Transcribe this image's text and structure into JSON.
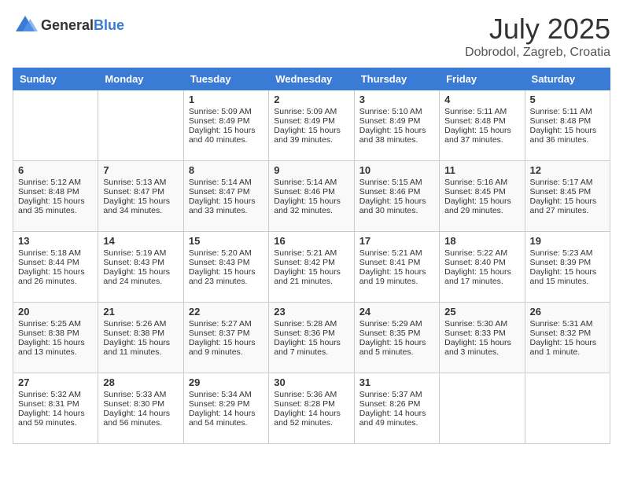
{
  "header": {
    "logo_general": "General",
    "logo_blue": "Blue",
    "month": "July 2025",
    "location": "Dobrodol, Zagreb, Croatia"
  },
  "weekdays": [
    "Sunday",
    "Monday",
    "Tuesday",
    "Wednesday",
    "Thursday",
    "Friday",
    "Saturday"
  ],
  "weeks": [
    [
      {
        "day": "",
        "sunrise": "",
        "sunset": "",
        "daylight": ""
      },
      {
        "day": "",
        "sunrise": "",
        "sunset": "",
        "daylight": ""
      },
      {
        "day": "1",
        "sunrise": "Sunrise: 5:09 AM",
        "sunset": "Sunset: 8:49 PM",
        "daylight": "Daylight: 15 hours and 40 minutes."
      },
      {
        "day": "2",
        "sunrise": "Sunrise: 5:09 AM",
        "sunset": "Sunset: 8:49 PM",
        "daylight": "Daylight: 15 hours and 39 minutes."
      },
      {
        "day": "3",
        "sunrise": "Sunrise: 5:10 AM",
        "sunset": "Sunset: 8:49 PM",
        "daylight": "Daylight: 15 hours and 38 minutes."
      },
      {
        "day": "4",
        "sunrise": "Sunrise: 5:11 AM",
        "sunset": "Sunset: 8:48 PM",
        "daylight": "Daylight: 15 hours and 37 minutes."
      },
      {
        "day": "5",
        "sunrise": "Sunrise: 5:11 AM",
        "sunset": "Sunset: 8:48 PM",
        "daylight": "Daylight: 15 hours and 36 minutes."
      }
    ],
    [
      {
        "day": "6",
        "sunrise": "Sunrise: 5:12 AM",
        "sunset": "Sunset: 8:48 PM",
        "daylight": "Daylight: 15 hours and 35 minutes."
      },
      {
        "day": "7",
        "sunrise": "Sunrise: 5:13 AM",
        "sunset": "Sunset: 8:47 PM",
        "daylight": "Daylight: 15 hours and 34 minutes."
      },
      {
        "day": "8",
        "sunrise": "Sunrise: 5:14 AM",
        "sunset": "Sunset: 8:47 PM",
        "daylight": "Daylight: 15 hours and 33 minutes."
      },
      {
        "day": "9",
        "sunrise": "Sunrise: 5:14 AM",
        "sunset": "Sunset: 8:46 PM",
        "daylight": "Daylight: 15 hours and 32 minutes."
      },
      {
        "day": "10",
        "sunrise": "Sunrise: 5:15 AM",
        "sunset": "Sunset: 8:46 PM",
        "daylight": "Daylight: 15 hours and 30 minutes."
      },
      {
        "day": "11",
        "sunrise": "Sunrise: 5:16 AM",
        "sunset": "Sunset: 8:45 PM",
        "daylight": "Daylight: 15 hours and 29 minutes."
      },
      {
        "day": "12",
        "sunrise": "Sunrise: 5:17 AM",
        "sunset": "Sunset: 8:45 PM",
        "daylight": "Daylight: 15 hours and 27 minutes."
      }
    ],
    [
      {
        "day": "13",
        "sunrise": "Sunrise: 5:18 AM",
        "sunset": "Sunset: 8:44 PM",
        "daylight": "Daylight: 15 hours and 26 minutes."
      },
      {
        "day": "14",
        "sunrise": "Sunrise: 5:19 AM",
        "sunset": "Sunset: 8:43 PM",
        "daylight": "Daylight: 15 hours and 24 minutes."
      },
      {
        "day": "15",
        "sunrise": "Sunrise: 5:20 AM",
        "sunset": "Sunset: 8:43 PM",
        "daylight": "Daylight: 15 hours and 23 minutes."
      },
      {
        "day": "16",
        "sunrise": "Sunrise: 5:21 AM",
        "sunset": "Sunset: 8:42 PM",
        "daylight": "Daylight: 15 hours and 21 minutes."
      },
      {
        "day": "17",
        "sunrise": "Sunrise: 5:21 AM",
        "sunset": "Sunset: 8:41 PM",
        "daylight": "Daylight: 15 hours and 19 minutes."
      },
      {
        "day": "18",
        "sunrise": "Sunrise: 5:22 AM",
        "sunset": "Sunset: 8:40 PM",
        "daylight": "Daylight: 15 hours and 17 minutes."
      },
      {
        "day": "19",
        "sunrise": "Sunrise: 5:23 AM",
        "sunset": "Sunset: 8:39 PM",
        "daylight": "Daylight: 15 hours and 15 minutes."
      }
    ],
    [
      {
        "day": "20",
        "sunrise": "Sunrise: 5:25 AM",
        "sunset": "Sunset: 8:38 PM",
        "daylight": "Daylight: 15 hours and 13 minutes."
      },
      {
        "day": "21",
        "sunrise": "Sunrise: 5:26 AM",
        "sunset": "Sunset: 8:38 PM",
        "daylight": "Daylight: 15 hours and 11 minutes."
      },
      {
        "day": "22",
        "sunrise": "Sunrise: 5:27 AM",
        "sunset": "Sunset: 8:37 PM",
        "daylight": "Daylight: 15 hours and 9 minutes."
      },
      {
        "day": "23",
        "sunrise": "Sunrise: 5:28 AM",
        "sunset": "Sunset: 8:36 PM",
        "daylight": "Daylight: 15 hours and 7 minutes."
      },
      {
        "day": "24",
        "sunrise": "Sunrise: 5:29 AM",
        "sunset": "Sunset: 8:35 PM",
        "daylight": "Daylight: 15 hours and 5 minutes."
      },
      {
        "day": "25",
        "sunrise": "Sunrise: 5:30 AM",
        "sunset": "Sunset: 8:33 PM",
        "daylight": "Daylight: 15 hours and 3 minutes."
      },
      {
        "day": "26",
        "sunrise": "Sunrise: 5:31 AM",
        "sunset": "Sunset: 8:32 PM",
        "daylight": "Daylight: 15 hours and 1 minute."
      }
    ],
    [
      {
        "day": "27",
        "sunrise": "Sunrise: 5:32 AM",
        "sunset": "Sunset: 8:31 PM",
        "daylight": "Daylight: 14 hours and 59 minutes."
      },
      {
        "day": "28",
        "sunrise": "Sunrise: 5:33 AM",
        "sunset": "Sunset: 8:30 PM",
        "daylight": "Daylight: 14 hours and 56 minutes."
      },
      {
        "day": "29",
        "sunrise": "Sunrise: 5:34 AM",
        "sunset": "Sunset: 8:29 PM",
        "daylight": "Daylight: 14 hours and 54 minutes."
      },
      {
        "day": "30",
        "sunrise": "Sunrise: 5:36 AM",
        "sunset": "Sunset: 8:28 PM",
        "daylight": "Daylight: 14 hours and 52 minutes."
      },
      {
        "day": "31",
        "sunrise": "Sunrise: 5:37 AM",
        "sunset": "Sunset: 8:26 PM",
        "daylight": "Daylight: 14 hours and 49 minutes."
      },
      {
        "day": "",
        "sunrise": "",
        "sunset": "",
        "daylight": ""
      },
      {
        "day": "",
        "sunrise": "",
        "sunset": "",
        "daylight": ""
      }
    ]
  ]
}
